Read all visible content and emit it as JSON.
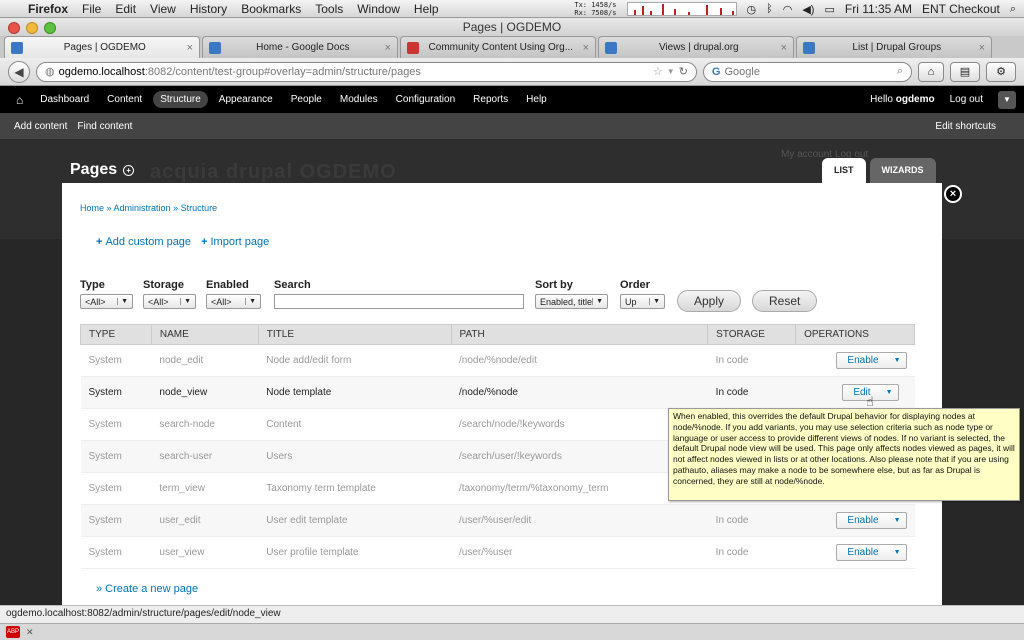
{
  "menubar": {
    "app_name": "Firefox",
    "items": [
      "File",
      "Edit",
      "View",
      "History",
      "Bookmarks",
      "Tools",
      "Window",
      "Help"
    ],
    "net_tx": "Tx:    1458/s",
    "net_rx": "Rx:    7508/s",
    "clock": "Fri 11:35 AM",
    "user": "ENT Checkout"
  },
  "window": {
    "title": "Pages | OGDEMO"
  },
  "tabs": [
    {
      "title": "Pages | OGDEMO",
      "active": true
    },
    {
      "title": "Home - Google Docs",
      "active": false
    },
    {
      "title": "Community Content Using Org...",
      "active": false
    },
    {
      "title": "Views | drupal.org",
      "active": false
    },
    {
      "title": "List | Drupal Groups",
      "active": false
    }
  ],
  "navbar": {
    "url_host": "ogdemo.localhost",
    "url_path": ":8082/content/test-group#overlay=admin/structure/pages",
    "search_placeholder": "Google"
  },
  "toolbar": {
    "items": [
      "Dashboard",
      "Content",
      "Structure",
      "Appearance",
      "People",
      "Modules",
      "Configuration",
      "Reports",
      "Help"
    ],
    "active_item": "Structure",
    "hello_prefix": "Hello ",
    "hello_user": "ogdemo",
    "logout": "Log out"
  },
  "shortcuts": {
    "items": [
      "Add content",
      "Find content"
    ],
    "edit": "Edit shortcuts"
  },
  "background": {
    "logo": "acquia drupal   OGDEMO",
    "account": "My account    Log out"
  },
  "overlay": {
    "title": "Pages",
    "tabs": [
      {
        "label": "LIST",
        "active": true
      },
      {
        "label": "WIZARDS",
        "active": false
      }
    ],
    "close_symbol": "×",
    "breadcrumb": [
      "Home",
      "Administration",
      "Structure"
    ],
    "breadcrumb_sep": " » ",
    "actions": [
      "Add custom page",
      "Import page"
    ],
    "filters": {
      "type": {
        "label": "Type",
        "value": "<All>"
      },
      "storage": {
        "label": "Storage",
        "value": "<All>"
      },
      "enabled": {
        "label": "Enabled",
        "value": "<All>"
      },
      "search": {
        "label": "Search",
        "value": ""
      },
      "sort_by": {
        "label": "Sort by",
        "value": "Enabled, title"
      },
      "order": {
        "label": "Order",
        "value": "Up"
      }
    },
    "apply": "Apply",
    "reset": "Reset",
    "columns": [
      "Type",
      "Name",
      "Title",
      "Path",
      "Storage",
      "Operations"
    ],
    "rows": [
      {
        "type": "System",
        "name": "node_edit",
        "title": "Node add/edit form",
        "path": "/node/%node/edit",
        "storage": "In code",
        "op": "Enable",
        "enabled": false
      },
      {
        "type": "System",
        "name": "node_view",
        "title": "Node template",
        "path": "/node/%node",
        "storage": "In code",
        "op": "Edit",
        "enabled": true
      },
      {
        "type": "System",
        "name": "search-node",
        "title": "Content",
        "path": "/search/node/!keywords",
        "storage": "",
        "op": "",
        "enabled": false
      },
      {
        "type": "System",
        "name": "search-user",
        "title": "Users",
        "path": "/search/user/!keywords",
        "storage": "",
        "op": "",
        "enabled": false
      },
      {
        "type": "System",
        "name": "term_view",
        "title": "Taxonomy term template",
        "path": "/taxonomy/term/%taxonomy_term",
        "storage": "",
        "op": "",
        "enabled": false
      },
      {
        "type": "System",
        "name": "user_edit",
        "title": "User edit template",
        "path": "/user/%user/edit",
        "storage": "In code",
        "op": "Enable",
        "enabled": false
      },
      {
        "type": "System",
        "name": "user_view",
        "title": "User profile template",
        "path": "/user/%user",
        "storage": "In code",
        "op": "Enable",
        "enabled": false
      }
    ],
    "create_link": "» Create a new page",
    "tooltip": "When enabled, this overrides the default Drupal behavior for displaying nodes at node/%node. If you add variants, you may use selection criteria such as node type or language or user access to provide different views of nodes. If no variant is selected, the default Drupal node view will be used. This page only affects nodes viewed as pages, it will not affect nodes viewed in lists or at other locations. Also please note that if you are using pathauto, aliases may make a node to be somewhere else, but as far as Drupal is concerned, they are still at node/%node."
  },
  "status_bar": {
    "text": "ogdemo.localhost:8082/admin/structure/pages/edit/node_view"
  },
  "addon_bar": {
    "icon_text": "ABP"
  },
  "colors": {
    "link": "#0074bd",
    "toolbar": "#000000",
    "tooltip_bg": "#ffffc5"
  },
  "icons": {
    "home": "home-icon",
    "back": "back-arrow-icon",
    "close": "close-icon"
  }
}
